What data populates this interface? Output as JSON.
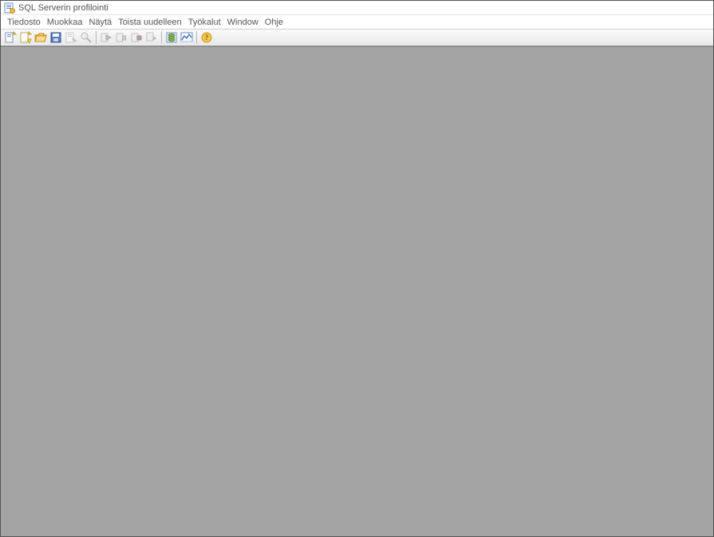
{
  "window": {
    "title": "SQL Serverin profilointi",
    "app_icon": "document-db-icon"
  },
  "menu": {
    "items": [
      {
        "id": "file",
        "label": "Tiedosto"
      },
      {
        "id": "edit",
        "label": "Muokkaa"
      },
      {
        "id": "view",
        "label": "Näytä"
      },
      {
        "id": "replay",
        "label": "Toista uudelleen"
      },
      {
        "id": "tools",
        "label": "Työkalut"
      },
      {
        "id": "window",
        "label": "Window"
      },
      {
        "id": "help",
        "label": "Ohje"
      }
    ]
  },
  "toolbar": {
    "buttons": [
      {
        "icon": "new-trace-icon",
        "name": "new-trace-button",
        "enabled": true
      },
      {
        "icon": "new-file-icon",
        "name": "new-template-button",
        "enabled": true
      },
      {
        "icon": "open-folder-icon",
        "name": "open-button",
        "enabled": true
      },
      {
        "icon": "save-icon",
        "name": "save-button",
        "enabled": true
      },
      {
        "icon": "properties-icon",
        "name": "properties-button",
        "enabled": false
      },
      {
        "icon": "find-icon",
        "name": "find-button",
        "enabled": false
      },
      {
        "sep": true
      },
      {
        "icon": "run-icon",
        "name": "run-button",
        "enabled": false
      },
      {
        "icon": "pause-icon",
        "name": "pause-button",
        "enabled": false
      },
      {
        "icon": "stop-icon",
        "name": "stop-button",
        "enabled": false
      },
      {
        "icon": "autoscroll-icon",
        "name": "autoscroll-button",
        "enabled": false
      },
      {
        "sep": true
      },
      {
        "icon": "tuning-advisor-icon",
        "name": "tuning-advisor-button",
        "enabled": true
      },
      {
        "icon": "activity-monitor-icon",
        "name": "activity-monitor-button",
        "enabled": true
      },
      {
        "sep": true
      },
      {
        "icon": "help-icon",
        "name": "help-button",
        "enabled": true
      }
    ]
  }
}
